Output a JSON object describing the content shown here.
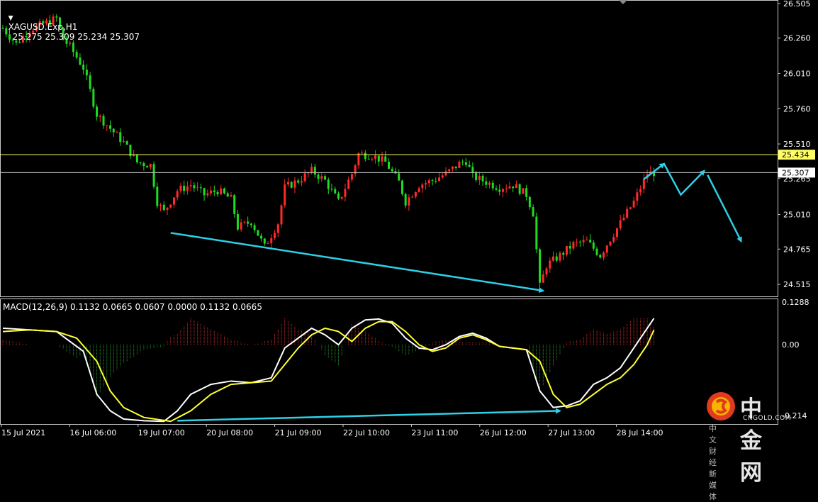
{
  "header": {
    "symbol": "XAGUSD.Exp,H1",
    "ohlc": "25.275 25.309 25.234 25.307",
    "macd_label": "MACD(12,26,9) 0.1132 0.0665 0.0607 0.0000 0.1132 0.0665"
  },
  "watermark": {
    "cn": "中金网",
    "en": "CNGOLD.COM",
    "sub": "中文财经新媒体"
  },
  "colors": {
    "background": "#000000",
    "bull": "#ff2a2a",
    "bear": "#1fdc1f",
    "hline": "#ffff66",
    "price_line": "#c0c0c0",
    "arrow": "#2ed0e6",
    "macd_line": "#ffffff",
    "signal_line": "#ffff33",
    "hist_pos": "#e03030",
    "hist_neg": "#2e9e2e"
  },
  "chart_data": {
    "type": "candlestick",
    "symbol": "XAGUSD",
    "timeframe": "H1",
    "x_tick_labels": [
      "15 Jul 2021",
      "16 Jul 06:00",
      "19 Jul 07:00",
      "20 Jul 08:00",
      "21 Jul 09:00",
      "22 Jul 10:00",
      "23 Jul 11:00",
      "26 Jul 12:00",
      "27 Jul 13:00",
      "28 Jul 14:00"
    ],
    "price_axis_ticks": [
      "26.505",
      "26.260",
      "26.010",
      "25.760",
      "25.510",
      "25.265",
      "25.010",
      "24.765",
      "24.515"
    ],
    "ylim": [
      24.43,
      26.53
    ],
    "horizontal_level": 25.434,
    "horizontal_level_label": "25.434",
    "current_price": 25.307,
    "current_price_label": "25.307",
    "price_path": [
      [
        0,
        26.33
      ],
      [
        4,
        26.22
      ],
      [
        8,
        26.32
      ],
      [
        12,
        26.36
      ],
      [
        16,
        26.4
      ],
      [
        18,
        26.25
      ],
      [
        20,
        26.2
      ],
      [
        24,
        26.05
      ],
      [
        28,
        25.72
      ],
      [
        32,
        25.62
      ],
      [
        36,
        25.52
      ],
      [
        40,
        25.38
      ],
      [
        44,
        25.36
      ],
      [
        46,
        25.1
      ],
      [
        48,
        25.03
      ],
      [
        52,
        25.18
      ],
      [
        56,
        25.22
      ],
      [
        60,
        25.15
      ],
      [
        64,
        25.18
      ],
      [
        68,
        25.12
      ],
      [
        70,
        24.92
      ],
      [
        74,
        24.96
      ],
      [
        78,
        24.78
      ],
      [
        82,
        24.95
      ],
      [
        84,
        25.2
      ],
      [
        88,
        25.25
      ],
      [
        92,
        25.32
      ],
      [
        96,
        25.25
      ],
      [
        100,
        25.1
      ],
      [
        104,
        25.3
      ],
      [
        106,
        25.44
      ],
      [
        110,
        25.43
      ],
      [
        114,
        25.38
      ],
      [
        118,
        25.24
      ],
      [
        120,
        25.1
      ],
      [
        124,
        25.22
      ],
      [
        128,
        25.25
      ],
      [
        132,
        25.3
      ],
      [
        136,
        25.37
      ],
      [
        138,
        25.39
      ],
      [
        140,
        25.28
      ],
      [
        144,
        25.24
      ],
      [
        148,
        25.2
      ],
      [
        152,
        25.22
      ],
      [
        156,
        25.15
      ],
      [
        158,
        25.02
      ],
      [
        160,
        24.5
      ],
      [
        162,
        24.65
      ],
      [
        166,
        24.72
      ],
      [
        170,
        24.8
      ],
      [
        174,
        24.82
      ],
      [
        178,
        24.72
      ],
      [
        180,
        24.8
      ],
      [
        184,
        24.95
      ],
      [
        188,
        25.1
      ],
      [
        192,
        25.3
      ],
      [
        194,
        25.307
      ]
    ],
    "annotations": [
      {
        "type": "trendline",
        "from": [
          50,
          24.88
        ],
        "to": [
          161,
          24.47
        ],
        "arrow": true
      },
      {
        "type": "arrow",
        "from": [
          191,
          25.26
        ],
        "to": [
          197,
          25.37
        ]
      },
      {
        "type": "polyline",
        "points": [
          [
            197,
            25.37
          ],
          [
            202,
            25.15
          ],
          [
            209,
            25.32
          ]
        ],
        "arrow": true
      },
      {
        "type": "arrow",
        "from": [
          210,
          25.29
        ],
        "to": [
          220,
          24.82
        ]
      }
    ],
    "macd": {
      "params": "12,26,9",
      "values": [
        0.1132,
        0.0665,
        0.0607,
        0.0,
        0.1132,
        0.0665
      ],
      "axis_ticks": [
        "0.1288",
        "0.00",
        "-0.214"
      ],
      "ylim": [
        -0.24,
        0.14
      ],
      "macd_path": [
        [
          0,
          0.05
        ],
        [
          8,
          0.045
        ],
        [
          16,
          0.04
        ],
        [
          20,
          0.01
        ],
        [
          24,
          -0.02
        ],
        [
          28,
          -0.15
        ],
        [
          32,
          -0.2
        ],
        [
          36,
          -0.225
        ],
        [
          42,
          -0.23
        ],
        [
          48,
          -0.232
        ],
        [
          52,
          -0.2
        ],
        [
          56,
          -0.15
        ],
        [
          62,
          -0.12
        ],
        [
          68,
          -0.11
        ],
        [
          74,
          -0.115
        ],
        [
          80,
          -0.1
        ],
        [
          84,
          -0.01
        ],
        [
          88,
          0.02
        ],
        [
          92,
          0.05
        ],
        [
          96,
          0.03
        ],
        [
          100,
          0.0
        ],
        [
          104,
          0.05
        ],
        [
          108,
          0.075
        ],
        [
          112,
          0.078
        ],
        [
          116,
          0.065
        ],
        [
          120,
          0.02
        ],
        [
          124,
          -0.01
        ],
        [
          128,
          -0.015
        ],
        [
          132,
          0.0
        ],
        [
          136,
          0.025
        ],
        [
          140,
          0.035
        ],
        [
          144,
          0.02
        ],
        [
          148,
          -0.005
        ],
        [
          152,
          -0.01
        ],
        [
          156,
          -0.015
        ],
        [
          160,
          -0.14
        ],
        [
          164,
          -0.19
        ],
        [
          168,
          -0.185
        ],
        [
          172,
          -0.17
        ],
        [
          176,
          -0.12
        ],
        [
          180,
          -0.1
        ],
        [
          184,
          -0.07
        ],
        [
          188,
          -0.01
        ],
        [
          192,
          0.05
        ],
        [
          194,
          0.08
        ]
      ],
      "signal_path": [
        [
          0,
          0.04
        ],
        [
          8,
          0.045
        ],
        [
          16,
          0.04
        ],
        [
          22,
          0.02
        ],
        [
          28,
          -0.05
        ],
        [
          32,
          -0.14
        ],
        [
          36,
          -0.19
        ],
        [
          42,
          -0.22
        ],
        [
          50,
          -0.232
        ],
        [
          56,
          -0.2
        ],
        [
          62,
          -0.15
        ],
        [
          68,
          -0.12
        ],
        [
          74,
          -0.115
        ],
        [
          80,
          -0.11
        ],
        [
          84,
          -0.06
        ],
        [
          88,
          -0.01
        ],
        [
          92,
          0.03
        ],
        [
          96,
          0.05
        ],
        [
          100,
          0.04
        ],
        [
          104,
          0.01
        ],
        [
          108,
          0.05
        ],
        [
          112,
          0.07
        ],
        [
          116,
          0.07
        ],
        [
          120,
          0.04
        ],
        [
          124,
          0.0
        ],
        [
          128,
          -0.02
        ],
        [
          132,
          -0.01
        ],
        [
          136,
          0.02
        ],
        [
          140,
          0.03
        ],
        [
          144,
          0.015
        ],
        [
          148,
          -0.005
        ],
        [
          152,
          -0.01
        ],
        [
          156,
          -0.015
        ],
        [
          160,
          -0.05
        ],
        [
          164,
          -0.15
        ],
        [
          168,
          -0.19
        ],
        [
          172,
          -0.18
        ],
        [
          176,
          -0.15
        ],
        [
          180,
          -0.12
        ],
        [
          184,
          -0.1
        ],
        [
          188,
          -0.06
        ],
        [
          192,
          0.0
        ],
        [
          194,
          0.045
        ]
      ],
      "annotations": [
        {
          "type": "trendline",
          "from": [
            52,
            -0.23
          ],
          "to": [
            166,
            -0.2
          ],
          "arrow": true
        }
      ]
    }
  }
}
